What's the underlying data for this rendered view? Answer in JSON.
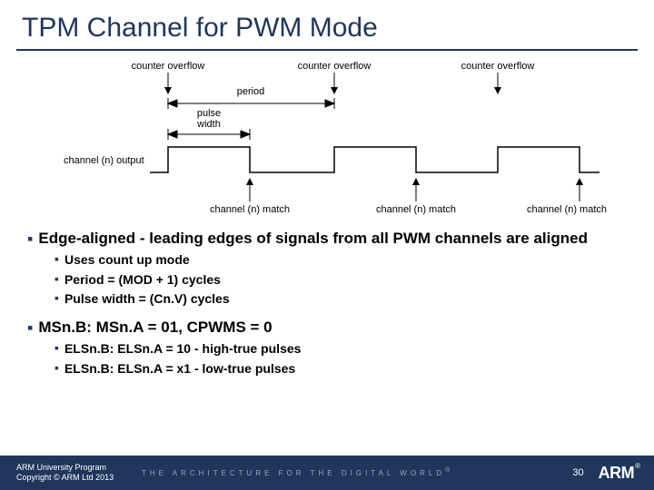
{
  "title": "TPM Channel for PWM Mode",
  "diagram": {
    "overflow_label": "counter overflow",
    "period_label": "period",
    "pulse_width_label_line1": "pulse",
    "pulse_width_label_line2": "width",
    "channel_output_label": "channel (n) output",
    "match_label": "channel (n) match"
  },
  "bullets": {
    "b1_text": "Edge-aligned - leading edges of signals from all PWM channels are aligned",
    "b1_sub": [
      "Uses count up mode",
      "Period = (MOD + 1) cycles",
      "Pulse width = (Cn.V) cycles"
    ],
    "b2_text": "MSn.B: MSn.A = 01, CPWMS = 0",
    "b2_sub": [
      "ELSn.B: ELSn.A = 10 - high-true pulses",
      "ELSn.B: ELSn.A = x1 - low-true pulses"
    ]
  },
  "footer": {
    "line1": "ARM University Program",
    "line2": "Copyright © ARM Ltd 2013",
    "tagline": "THE ARCHITECTURE FOR THE DIGITAL WORLD",
    "page": "30",
    "logo": "ARM",
    "reg": "®"
  }
}
